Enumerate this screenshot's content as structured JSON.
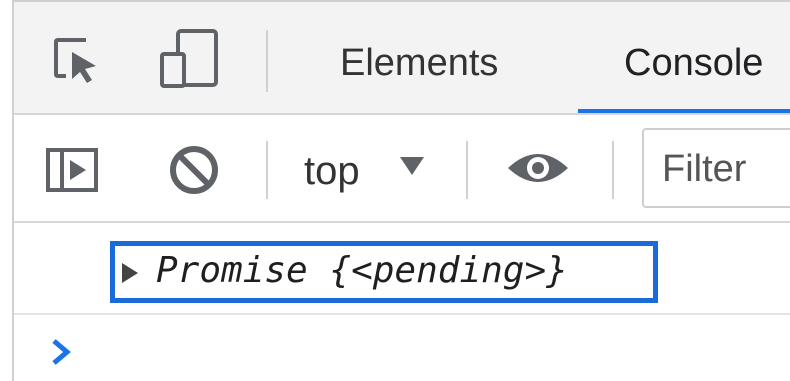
{
  "tabs": {
    "elements_label": "Elements",
    "console_label": "Console"
  },
  "toolbar": {
    "context_label": "top",
    "filter_placeholder": "Filter"
  },
  "console": {
    "entries": [
      {
        "type_name": "Promise",
        "state": "{<pending>}"
      }
    ]
  },
  "colors": {
    "accent": "#1a73e8",
    "highlight": "#1a6ad9",
    "prompt": "#1a73e8"
  },
  "icons": {
    "inspect": "inspect-element-icon",
    "device": "device-toggle-icon",
    "sidebar": "sidebar-toggle-icon",
    "clear": "clear-console-icon",
    "eye": "live-expression-icon",
    "prompt": "prompt-chevron-icon"
  }
}
